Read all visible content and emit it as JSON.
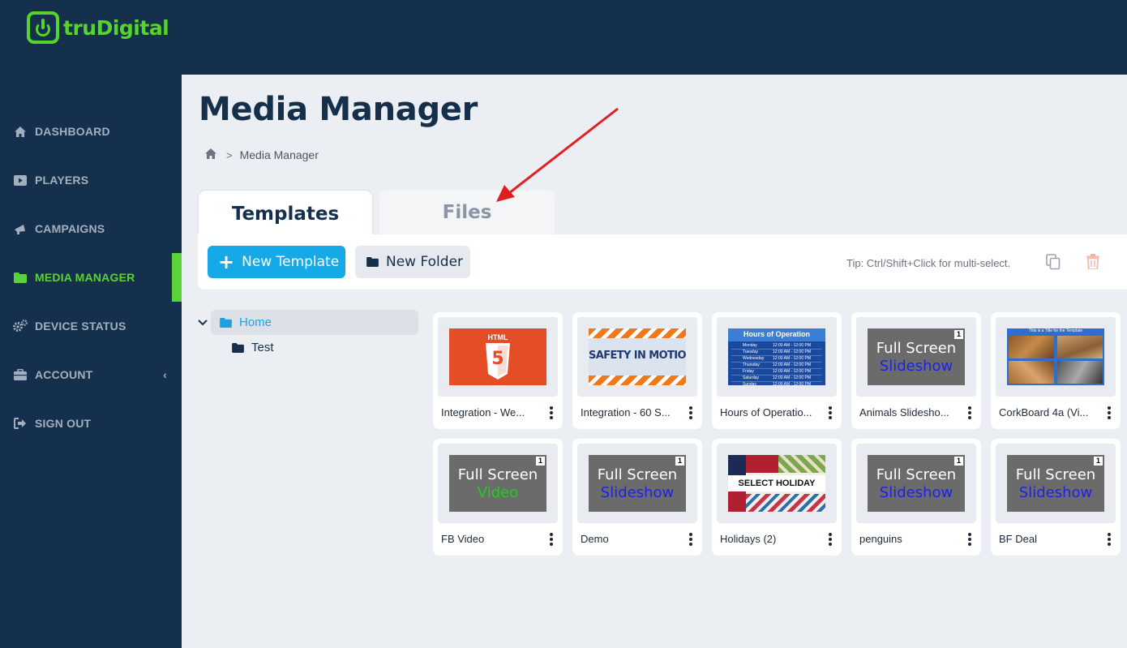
{
  "brand": {
    "name": "truDigital",
    "accent": "#55d42b"
  },
  "nav": {
    "items": [
      {
        "label": "DASHBOARD",
        "icon": "home-icon"
      },
      {
        "label": "PLAYERS",
        "icon": "play-icon"
      },
      {
        "label": "CAMPAIGNS",
        "icon": "megaphone-icon"
      },
      {
        "label": "MEDIA MANAGER",
        "icon": "folder-icon",
        "active": true
      },
      {
        "label": "DEVICE STATUS",
        "icon": "gears-icon"
      },
      {
        "label": "ACCOUNT",
        "icon": "briefcase-icon",
        "chevron": "‹"
      },
      {
        "label": "SIGN OUT",
        "icon": "sign-out-icon"
      }
    ]
  },
  "page": {
    "title": "Media Manager",
    "breadcrumb": {
      "sep": ">",
      "current": "Media Manager"
    }
  },
  "tabs": {
    "templates": "Templates",
    "files": "Files"
  },
  "toolbar": {
    "new_template": "New Template",
    "new_folder": "New Folder",
    "tip": "Tip: Ctrl/Shift+Click for multi-select."
  },
  "tree": {
    "home": "Home",
    "test": "Test"
  },
  "thumbs": {
    "html": "HTML",
    "html_shield": "5",
    "safety": "SAFETY IN MOTION",
    "hours_title": "Hours of Operation",
    "hours_days": [
      "Monday",
      "Tuesday",
      "Wednesday",
      "Thursday",
      "Friday",
      "Saturday",
      "Sunday"
    ],
    "hours_time": "12:00 AM - 12:00 PM",
    "corkboard_title": "This is a Title for the Template",
    "full_screen": "Full Screen",
    "slideshow": "Slideshow",
    "video": "Video",
    "badge": "1",
    "holiday": "SELECT HOLIDAY"
  },
  "cards": [
    {
      "name": "Integration - We..."
    },
    {
      "name": "Integration - 60 S..."
    },
    {
      "name": "Hours of Operatio..."
    },
    {
      "name": "Animals Slidesho..."
    },
    {
      "name": "CorkBoard 4a (Vi..."
    },
    {
      "name": "FB Video"
    },
    {
      "name": "Demo"
    },
    {
      "name": "Holidays (2)"
    },
    {
      "name": "penguins"
    },
    {
      "name": "BF Deal"
    }
  ]
}
